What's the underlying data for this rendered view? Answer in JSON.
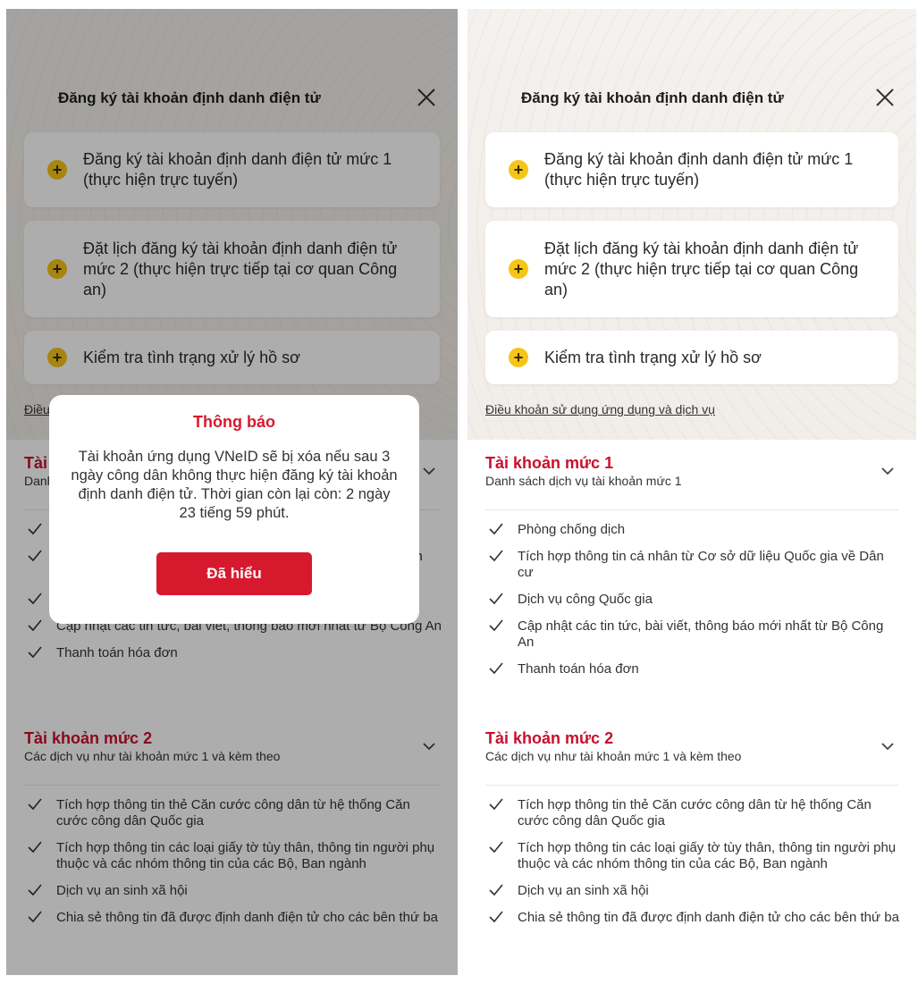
{
  "header": {
    "title": "Đăng ký tài khoản định danh điện tử"
  },
  "cards": [
    {
      "label": "Đăng ký tài khoản định danh điện tử mức 1 (thực hiện trực tuyến)"
    },
    {
      "label": "Đặt lịch đăng ký tài khoản định danh điện tử mức 2 (thực hiện trực tiếp tại cơ quan Công an)"
    },
    {
      "label": "Kiểm tra tình trạng xử lý hồ sơ"
    }
  ],
  "terms_link": "Điều khoản sử dụng ứng dụng và dịch vụ",
  "sections": [
    {
      "title": "Tài khoản mức 1",
      "subtitle": "Danh sách dịch vụ tài khoản mức 1",
      "items": [
        "Phòng chống dịch",
        "Tích hợp thông tin cá nhân từ Cơ sở dữ liệu Quốc gia về Dân cư",
        "Dịch vụ công Quốc gia",
        "Cập nhật các tin tức, bài viết, thông báo mới nhất từ Bộ Công An",
        "Thanh toán hóa đơn"
      ]
    },
    {
      "title": "Tài khoản mức 2",
      "subtitle": "Các dịch vụ như tài khoản mức 1 và kèm theo",
      "items": [
        "Tích hợp thông tin thẻ Căn cước công dân từ hệ thống Căn cước công dân Quốc gia",
        "Tích hợp thông tin các loại giấy tờ tùy thân, thông tin người phụ thuộc và các nhóm thông tin của các Bộ, Ban ngành",
        "Dịch vụ an sinh xã hội",
        "Chia sẻ thông tin đã được định danh điện tử cho các bên thứ ba"
      ]
    }
  ],
  "dialog": {
    "title": "Thông báo",
    "message": "Tài khoản ứng dụng VNeID sẽ bị xóa nếu sau 3 ngày công dân không thực hiện đăng ký tài khoản định danh điện tử. Thời gian còn lại còn: 2 ngày 23 tiếng 59 phút.",
    "button": "Đã hiểu"
  },
  "colors": {
    "accent_red": "#d7192e",
    "plus_yellow": "#f5c518"
  },
  "icons": {
    "close": "close-icon",
    "plus": "plus-icon",
    "chevron": "chevron-down-icon",
    "check": "check-icon"
  }
}
